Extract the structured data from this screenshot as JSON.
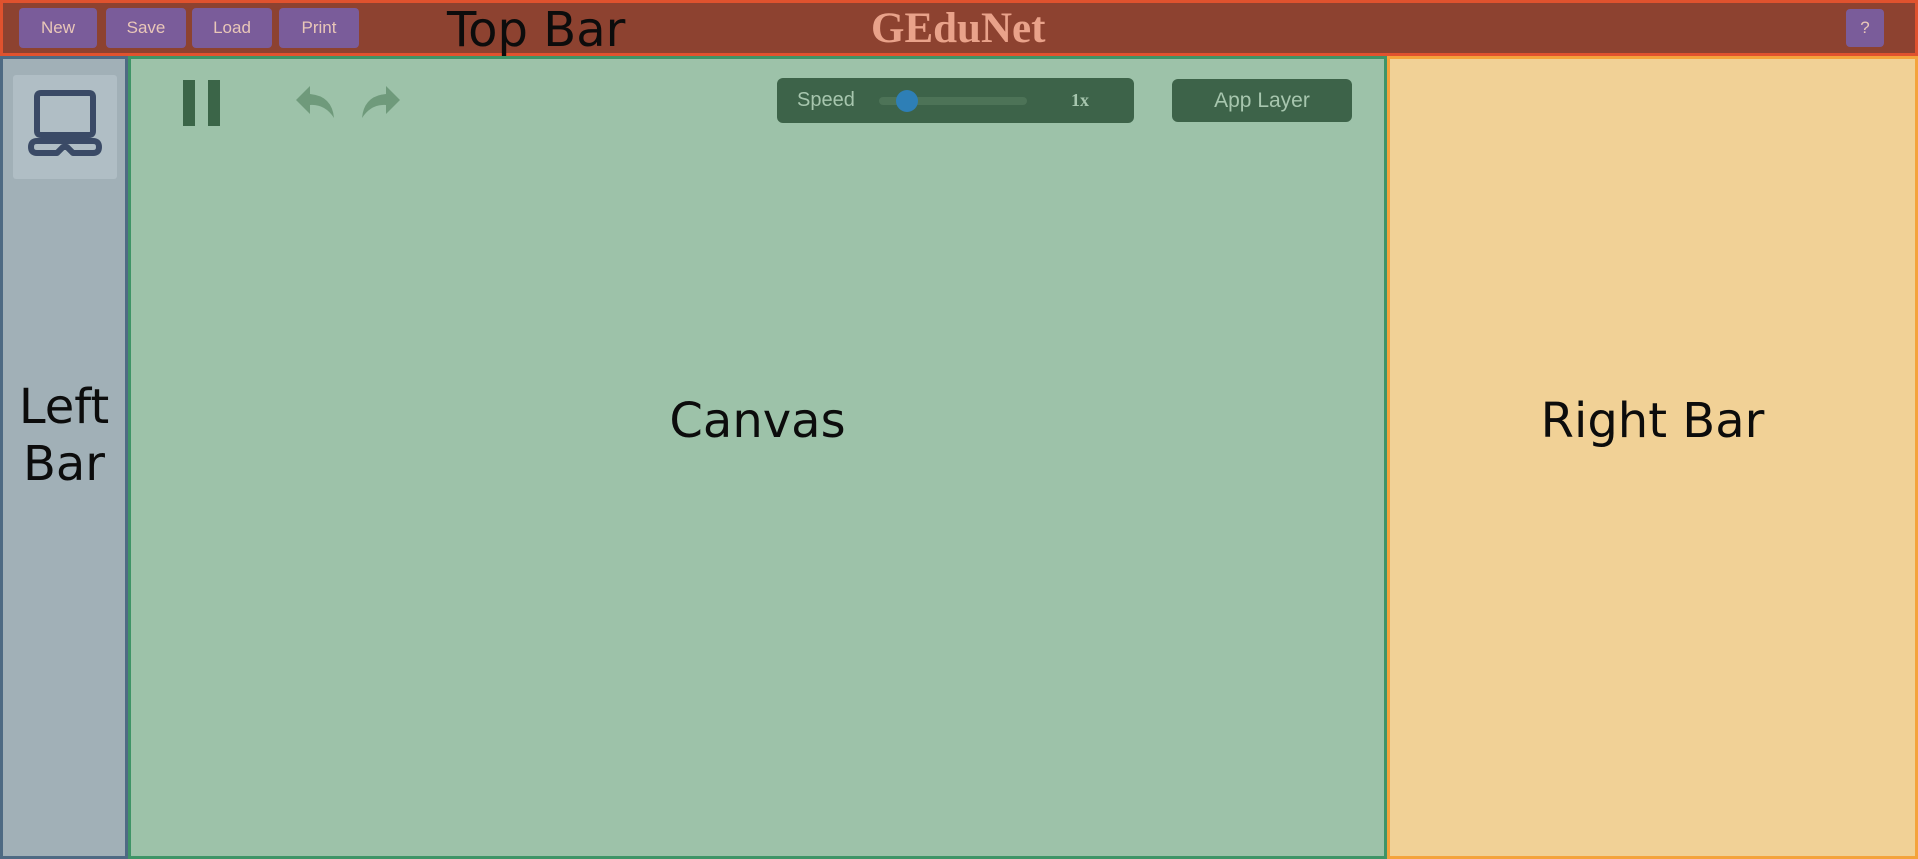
{
  "top_bar": {
    "zone_label": "Top Bar",
    "brand": "GEduNet",
    "buttons": {
      "new": "New",
      "save": "Save",
      "load": "Load",
      "print": "Print",
      "help": "?"
    }
  },
  "left_bar": {
    "zone_label": "Left Bar",
    "device_icon": "computer-icon"
  },
  "canvas": {
    "zone_label": "Canvas",
    "controls": {
      "pause_icon": "pause-icon",
      "undo_icon": "undo-icon",
      "redo_icon": "redo-icon",
      "speed_label": "Speed",
      "speed_value": "1x",
      "speed_level": 0.19,
      "app_layer_label": "App Layer"
    }
  },
  "right_bar": {
    "zone_label": "Right Bar"
  },
  "colors": {
    "top_bar_bg": "#8d4230",
    "top_bar_border": "#e0522e",
    "button_bg": "#7a5c9a",
    "brand": "#e9a28a",
    "left_bar_bg": "#a1b0b7",
    "canvas_bg": "#9dc2a9",
    "canvas_controls_bg": "#3d6349",
    "speed_knob": "#2e7fb6",
    "right_bar_bg": "#f1d196",
    "right_bar_border": "#f4a33c"
  }
}
